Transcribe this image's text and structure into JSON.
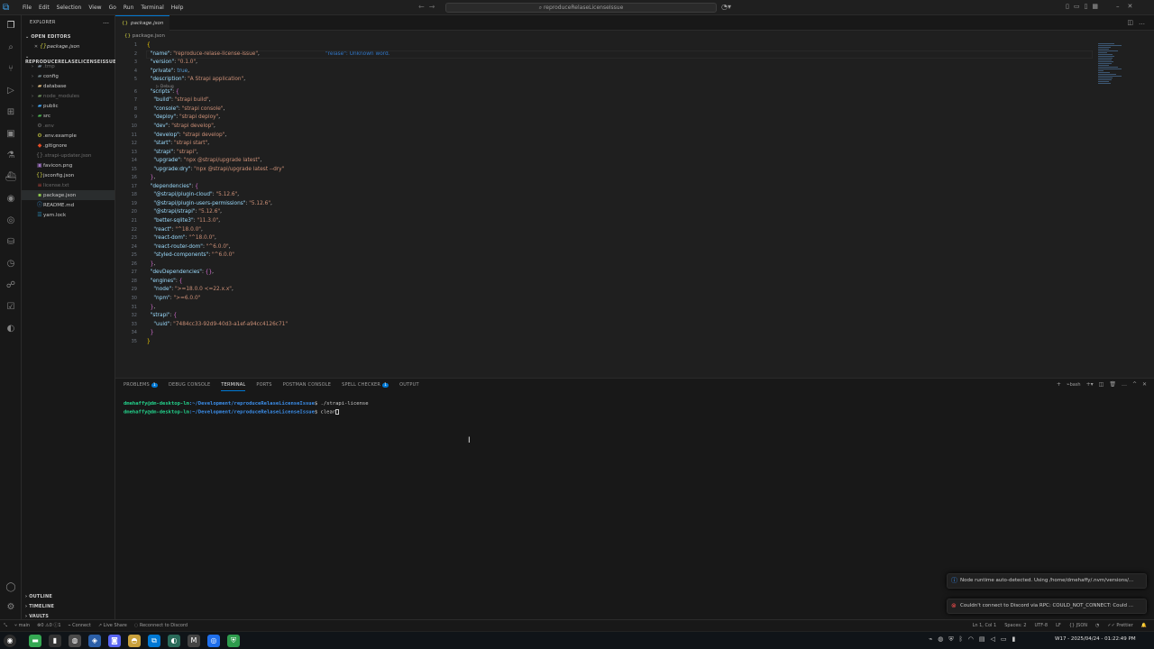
{
  "titlebar": {
    "menu": [
      "File",
      "Edit",
      "Selection",
      "View",
      "Go",
      "Run",
      "Terminal",
      "Help"
    ],
    "command_center": "reproduceRelaseLicenseIssue"
  },
  "sidebar": {
    "header": "EXPLORER",
    "open_editors_label": "OPEN EDITORS",
    "open_editor_file": "package.json",
    "project_label": "REPRODUCERELASELICENSEISSUE",
    "items": [
      {
        "label": ".tmp",
        "kind": "folder",
        "dim": true
      },
      {
        "label": "config",
        "kind": "folder",
        "dim": false
      },
      {
        "label": "database",
        "kind": "folder",
        "dim": false
      },
      {
        "label": "node_modules",
        "kind": "folder",
        "dim": true
      },
      {
        "label": "public",
        "kind": "folder",
        "dim": false
      },
      {
        "label": "src",
        "kind": "folder",
        "dim": false
      },
      {
        "label": ".env",
        "kind": "file",
        "dim": true
      },
      {
        "label": ".env.example",
        "kind": "file",
        "dim": false
      },
      {
        "label": ".gitignore",
        "kind": "file",
        "dim": false
      },
      {
        "label": ".strapi-updater.json",
        "kind": "file",
        "dim": true
      },
      {
        "label": "favicon.png",
        "kind": "file",
        "dim": false
      },
      {
        "label": "jsconfig.json",
        "kind": "file",
        "dim": false
      },
      {
        "label": "license.txt",
        "kind": "file",
        "dim": true
      },
      {
        "label": "package.json",
        "kind": "file",
        "dim": false,
        "selected": true
      },
      {
        "label": "README.md",
        "kind": "file",
        "dim": false
      },
      {
        "label": "yarn.lock",
        "kind": "file",
        "dim": false
      }
    ],
    "outline_label": "OUTLINE",
    "timeline_label": "TIMELINE",
    "vaults_label": "VAULTS"
  },
  "editor": {
    "tab_label": "package.json",
    "breadcrumb": "package.json",
    "diagnostic": "\"relase\": Unknown word.",
    "codelens": "▷ Debug",
    "lines": [
      "{",
      "  \"name\": \"reproduce-relase-license-issue\",",
      "  \"version\": \"0.1.0\",",
      "  \"private\": true,",
      "  \"description\": \"A Strapi application\",",
      "  \"scripts\": {",
      "    \"build\": \"strapi build\",",
      "    \"console\": \"strapi console\",",
      "    \"deploy\": \"strapi deploy\",",
      "    \"dev\": \"strapi develop\",",
      "    \"develop\": \"strapi develop\",",
      "    \"start\": \"strapi start\",",
      "    \"strapi\": \"strapi\",",
      "    \"upgrade\": \"npx @strapi/upgrade latest\",",
      "    \"upgrade:dry\": \"npx @strapi/upgrade latest --dry\"",
      "  },",
      "  \"dependencies\": {",
      "    \"@strapi/plugin-cloud\": \"5.12.6\",",
      "    \"@strapi/plugin-users-permissions\": \"5.12.6\",",
      "    \"@strapi/strapi\": \"5.12.6\",",
      "    \"better-sqlite3\": \"11.3.0\",",
      "    \"react\": \"^18.0.0\",",
      "    \"react-dom\": \"^18.0.0\",",
      "    \"react-router-dom\": \"^6.0.0\",",
      "    \"styled-components\": \"^6.0.0\"",
      "  },",
      "  \"devDependencies\": {},",
      "  \"engines\": {",
      "    \"node\": \">=18.0.0 <=22.x.x\",",
      "    \"npm\": \">=6.0.0\"",
      "  },",
      "  \"strapi\": {",
      "    \"uuid\": \"7484cc33-92d9-40d3-a1ef-a94cc4126c71\"",
      "  }",
      "}"
    ]
  },
  "panel": {
    "tabs": [
      "PROBLEMS",
      "DEBUG CONSOLE",
      "TERMINAL",
      "PORTS",
      "POSTMAN CONSOLE",
      "SPELL CHECKER",
      "OUTPUT"
    ],
    "problems_count": "1",
    "spell_count": "1",
    "shell_label": "bash",
    "terminal_lines": [
      {
        "user": "dmehaffy@dm-desktop-lm",
        "path": ":~/Development/reproduceRelaseLicenseIssue",
        "cmd": "$ ./strapi-license"
      },
      {
        "user": "dmehaffy@dm-desktop-lm",
        "path": ":~/Development/reproduceRelaseLicenseIssue",
        "cmd": "$ clear"
      }
    ]
  },
  "notifications": [
    {
      "text": "Node runtime auto-detected. Using /home/dmehaffy/.nvm/versions/...",
      "kind": "info"
    },
    {
      "text": "Couldn't connect to Discord via RPC: COULD_NOT_CONNECT: Could ...",
      "kind": "error"
    }
  ],
  "statusbar": {
    "branch": "main",
    "errors": "0",
    "warnings": "0",
    "info": "1",
    "connect": "Connect",
    "live_share": "Live Share",
    "discord": "Reconnect to Discord",
    "cursor": "Ln 1, Col 1",
    "spaces": "Spaces: 2",
    "encoding": "UTF-8",
    "eol": "LF",
    "language": "JSON",
    "prettier": "Prettier"
  },
  "taskbar": {
    "clock": "W17 - 2025/04/24 - 01:22:49 PM"
  },
  "colors": {
    "accent": "#0078d4",
    "json_key": "#9cdcfe",
    "json_string": "#ce9178",
    "terminal_user": "#23d18b",
    "terminal_path": "#3b8eea"
  }
}
